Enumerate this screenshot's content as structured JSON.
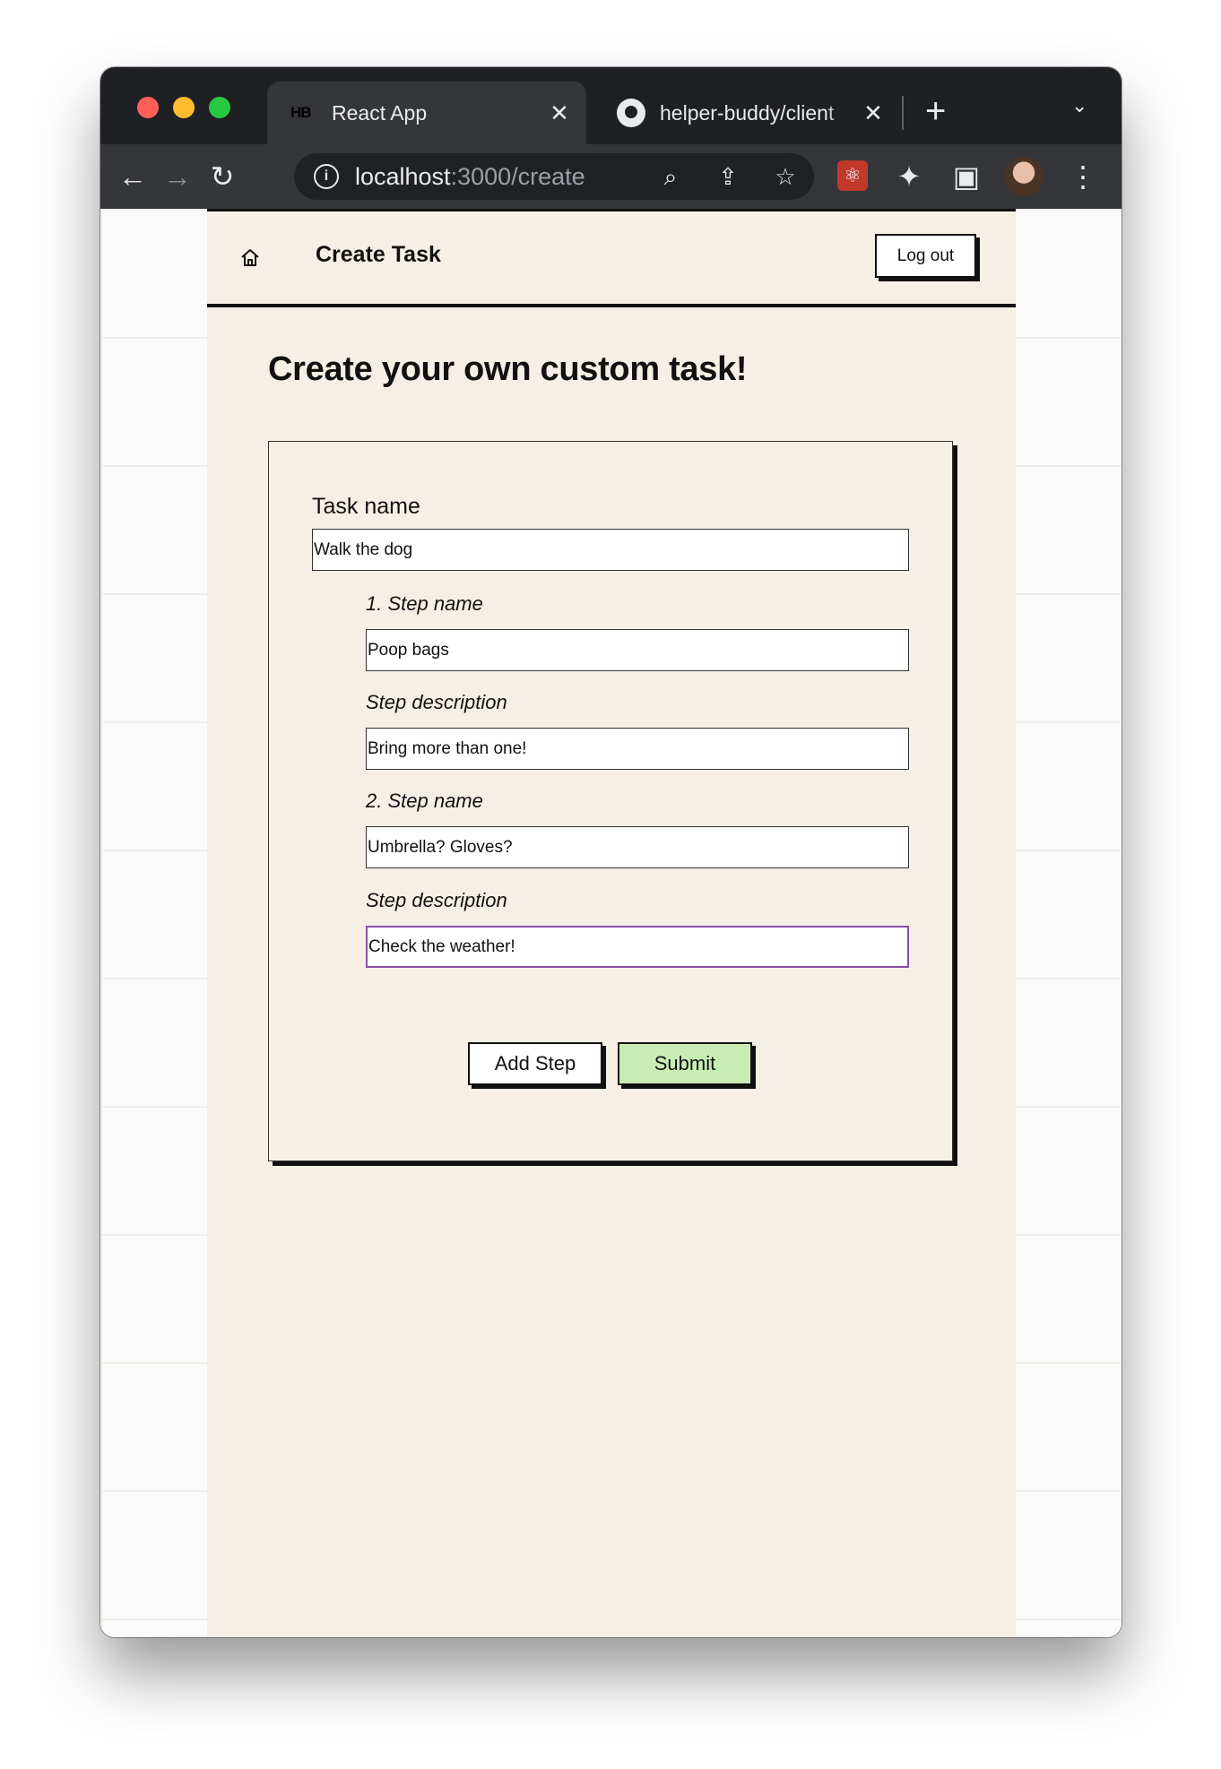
{
  "browser": {
    "tabs": [
      {
        "favicon": "HB",
        "title": "React App",
        "active": true
      },
      {
        "favicon": "github-icon",
        "title": "helper-buddy/client",
        "active": false
      }
    ],
    "url_host": "localhost",
    "url_path": ":3000/create"
  },
  "header": {
    "title": "Create Task",
    "logout_label": "Log out"
  },
  "main": {
    "heading": "Create your own custom task!"
  },
  "form": {
    "task_label": "Task name",
    "task_value": "Walk the dog",
    "steps": [
      {
        "name_label": "1. Step name",
        "name_value": "Poop bags",
        "desc_label": "Step description",
        "desc_value": "Bring more than one!"
      },
      {
        "name_label": "2. Step name",
        "name_value": "Umbrella? Gloves?",
        "desc_label": "Step description",
        "desc_value": "Check the weather!"
      }
    ],
    "add_step_label": "Add Step",
    "submit_label": "Submit"
  },
  "colors": {
    "page_bg": "#f6efe6",
    "submit_bg": "#c8edb4",
    "focus_border": "#8b4fa8"
  }
}
